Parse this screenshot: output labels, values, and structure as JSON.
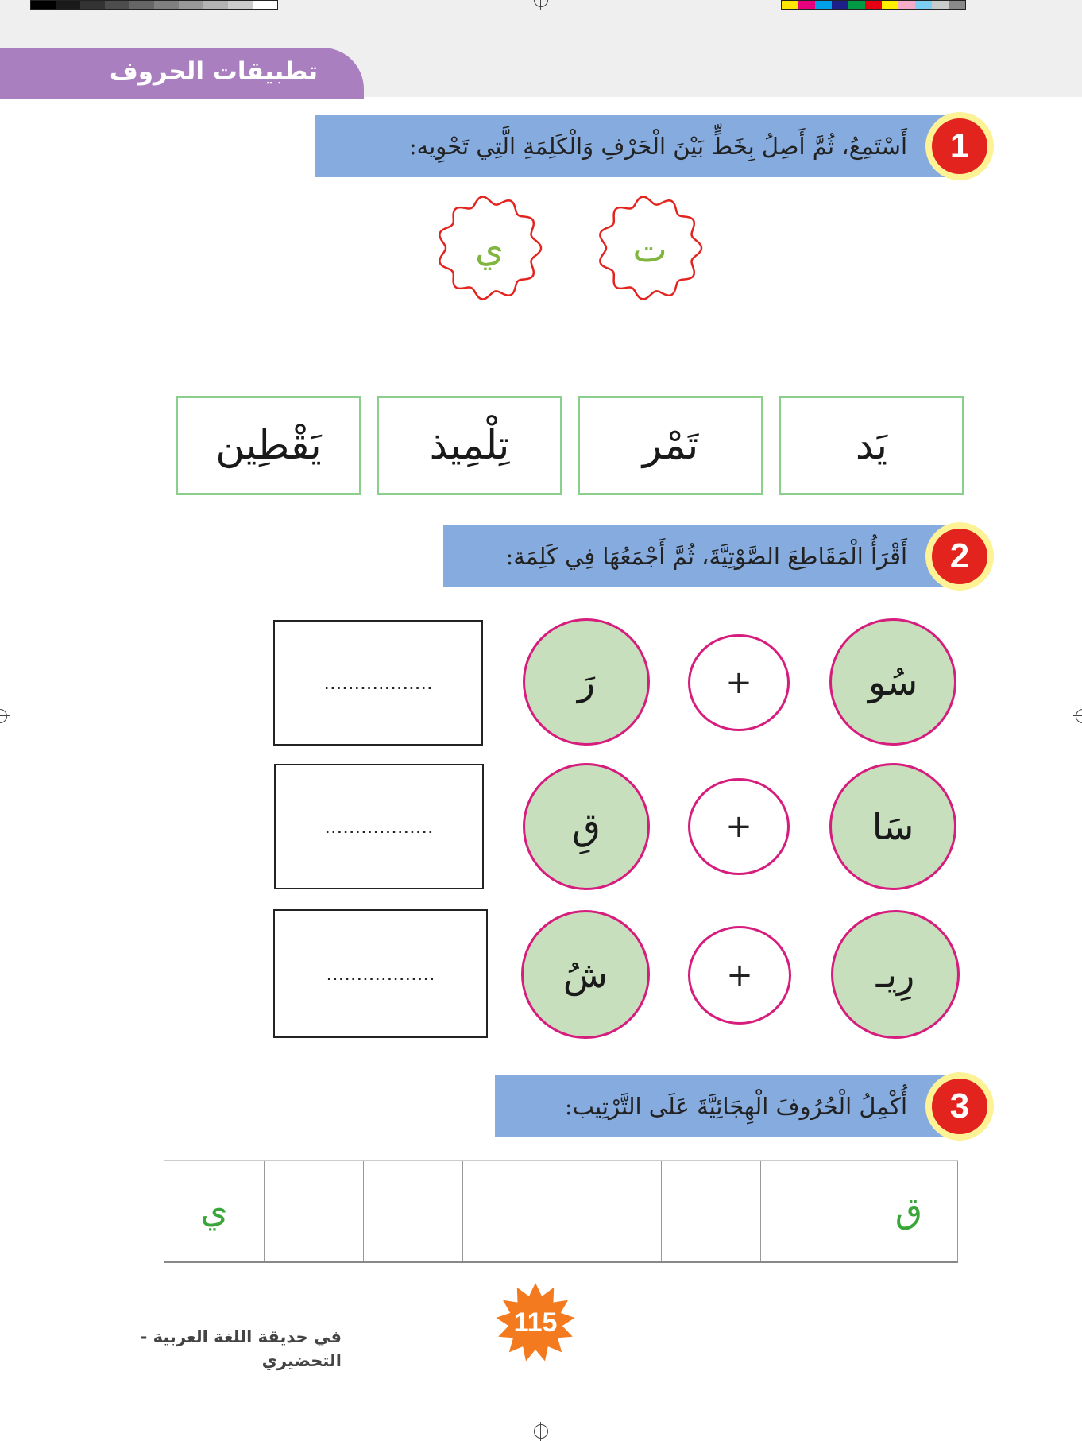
{
  "header": {
    "title": "تطبيقات الحروف"
  },
  "exercises": [
    {
      "number": "1",
      "instruction": "أَسْتَمِعُ، ثُمَّ أَصِلُ بِخَطٍّ بَيْنَ الْحَرْفِ وَالْكَلِمَةِ الَّتِي تَحْوِيه:"
    },
    {
      "number": "2",
      "instruction": "أَقْرَأُ الْمَقَاطِعَ الصَّوْتِيَّةَ، ثُمَّ أَجْمَعُهَا فِي كَلِمَة:"
    },
    {
      "number": "3",
      "instruction": "أُكْمِلُ الْحُرُوفَ الْهِجَائِيَّةَ عَلَى التَّرْتِيب:"
    }
  ],
  "letters": [
    "ي",
    "ت"
  ],
  "words": [
    "يَد",
    "تَمْر",
    "تِلْمِيذ",
    "يَقْطِين"
  ],
  "syllables": [
    {
      "first": "سُو",
      "second": "رَ",
      "plus": "+",
      "answer": ".................."
    },
    {
      "first": "سَا",
      "second": "قِ",
      "plus": "+",
      "answer": ".................."
    },
    {
      "first": "رِيـ",
      "second": "شُ",
      "plus": "+",
      "answer": ".................."
    }
  ],
  "alphabet_row": {
    "first": "ق",
    "last": "ي"
  },
  "footer": {
    "book_title": "في حديقة اللغة العربية - التحضيري",
    "page_number": "115"
  },
  "colors": {
    "purple_tab": "#a97fc0",
    "banner_blue": "#86abdf",
    "number_red": "#e3231e",
    "number_ring": "#fdf296",
    "flower_red": "#e3231e",
    "letter_green": "#80b540",
    "word_border": "#8ccf8c",
    "syllable_fill": "#c7dfbd",
    "syllable_border": "#d61c7d",
    "star_orange": "#f47a20"
  }
}
